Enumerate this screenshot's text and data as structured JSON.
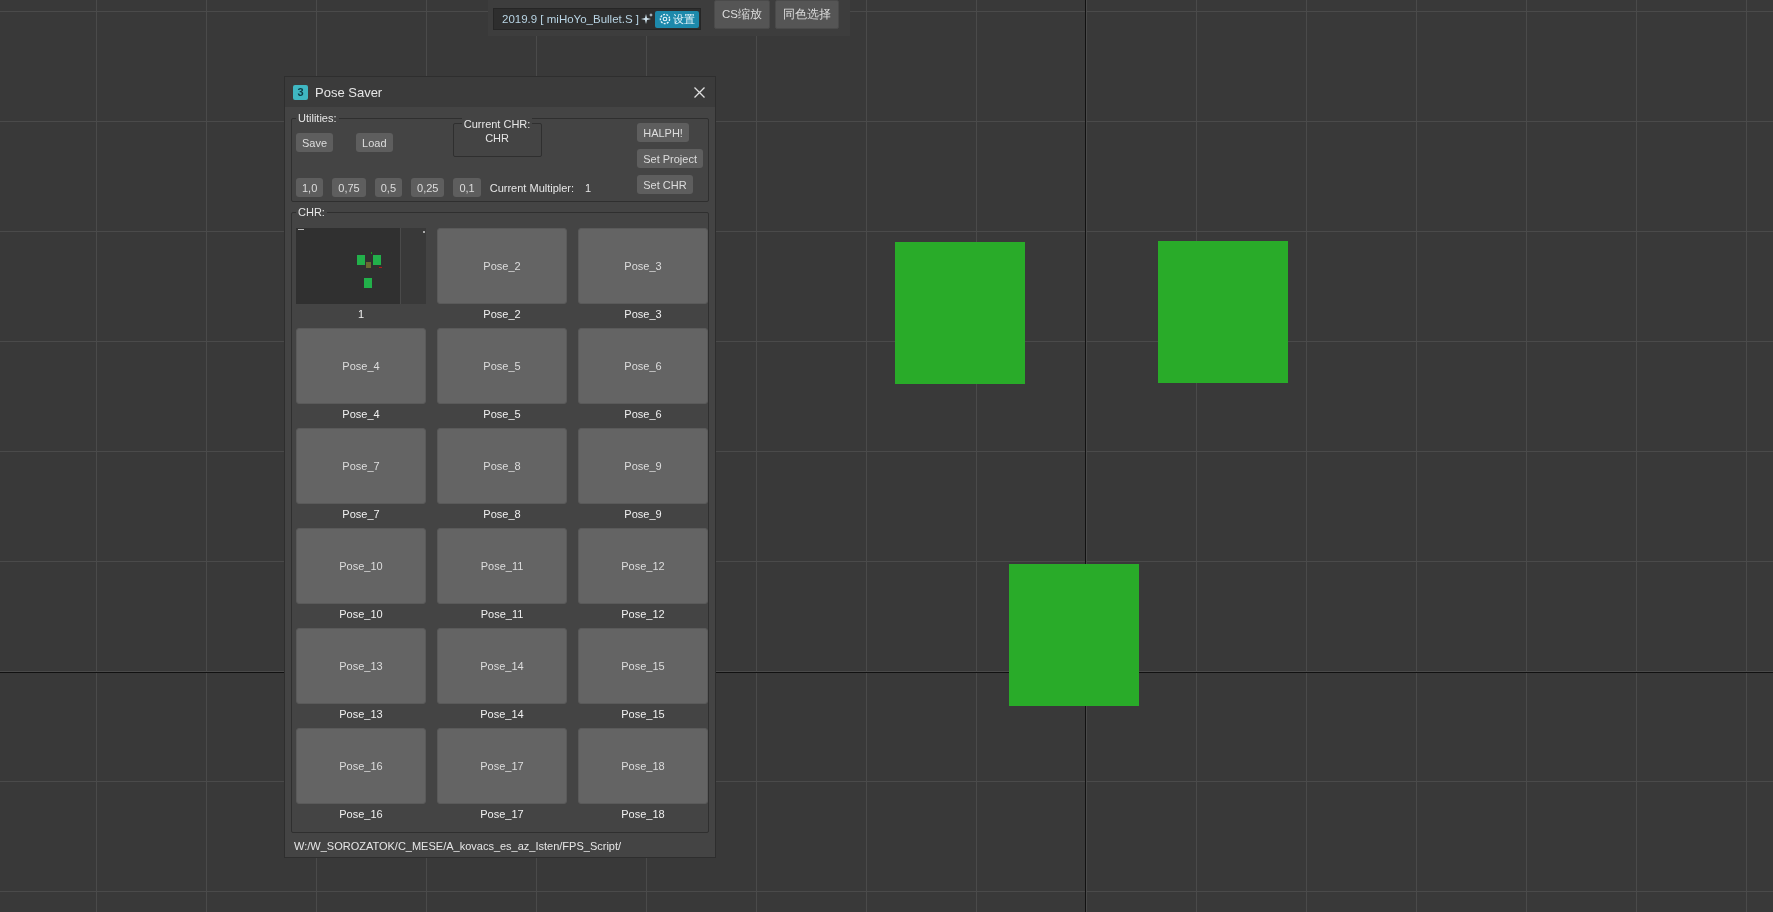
{
  "toolbar": {
    "version_label": "2019.9 [ miHoYo_Bullet.S ]",
    "settings_button": "设置",
    "buttons": [
      "CS缩放",
      "同色选择"
    ]
  },
  "dialog": {
    "icon_glyph": "3",
    "title": "Pose Saver",
    "utilities": {
      "label": "Utilities:",
      "buttons": [
        "Save",
        "Load"
      ],
      "current_chr": {
        "label": "Current CHR:",
        "value": "CHR"
      },
      "side_buttons": [
        "HALPH!",
        "Set Project",
        "Set CHR"
      ],
      "multipliers": [
        "1,0",
        "0,75",
        "0,5",
        "0,25",
        "0,1"
      ],
      "multiplier_label": "Current Multipler:",
      "multiplier_value": "1"
    },
    "chr_group": {
      "label": "CHR:",
      "pose_rows": [
        [
          {
            "kind": "picture",
            "caption": "1"
          },
          {
            "kind": "button",
            "text": "Pose_2",
            "caption": "Pose_2"
          },
          {
            "kind": "button",
            "text": "Pose_3",
            "caption": "Pose_3"
          }
        ],
        [
          {
            "kind": "button",
            "text": "Pose_4",
            "caption": "Pose_4"
          },
          {
            "kind": "button",
            "text": "Pose_5",
            "caption": "Pose_5"
          },
          {
            "kind": "button",
            "text": "Pose_6",
            "caption": "Pose_6"
          }
        ],
        [
          {
            "kind": "button",
            "text": "Pose_7",
            "caption": "Pose_7"
          },
          {
            "kind": "button",
            "text": "Pose_8",
            "caption": "Pose_8"
          },
          {
            "kind": "button",
            "text": "Pose_9",
            "caption": "Pose_9"
          }
        ],
        [
          {
            "kind": "button",
            "text": "Pose_10",
            "caption": "Pose_10"
          },
          {
            "kind": "button",
            "text": "Pose_11",
            "caption": "Pose_11"
          },
          {
            "kind": "button",
            "text": "Pose_12",
            "caption": "Pose_12"
          }
        ],
        [
          {
            "kind": "button",
            "text": "Pose_13",
            "caption": "Pose_13"
          },
          {
            "kind": "button",
            "text": "Pose_14",
            "caption": "Pose_14"
          },
          {
            "kind": "button",
            "text": "Pose_15",
            "caption": "Pose_15"
          }
        ],
        [
          {
            "kind": "button",
            "text": "Pose_16",
            "caption": "Pose_16"
          },
          {
            "kind": "button",
            "text": "Pose_17",
            "caption": "Pose_17"
          },
          {
            "kind": "button",
            "text": "Pose_18",
            "caption": "Pose_18"
          }
        ]
      ]
    },
    "path": "W:/W_SOROZATOK/C_MESE/A_kovacs_es_az_Isten/FPS_Script/"
  }
}
